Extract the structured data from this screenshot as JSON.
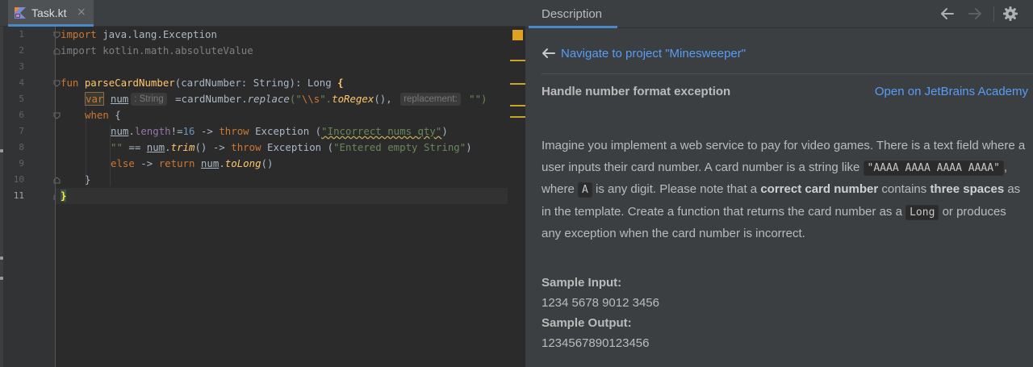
{
  "editor": {
    "tab": {
      "label": "Task.kt",
      "close": "×"
    },
    "line_numbers": [
      "1",
      "2",
      "3",
      "4",
      "5",
      "6",
      "7",
      "8",
      "9",
      "10",
      "11"
    ],
    "current_line": "11",
    "code": {
      "l1": {
        "kw": "import",
        "text": " java.lang.Exception"
      },
      "l2": {
        "text": "import kotlin.math.absoluteValue"
      },
      "l4": {
        "kw": "fun",
        "name": " parseCardNumber",
        "params": "(cardNumber: String): Long ",
        "brace": "{"
      },
      "l5": {
        "kw": "var",
        "name": "num",
        "hint": ": String",
        "assign": " =cardNumber.",
        "call": "replace",
        "open": "(\"",
        "esc": "\\\\s",
        "close": "\".",
        "call2": "toRegex",
        "after": "(), ",
        "hint2": "replacement:",
        "tail": " \"\")"
      },
      "l6": {
        "kw": "when",
        "text": " {"
      },
      "l7": {
        "var": "num",
        "dot": ".",
        "prop": "length",
        "op": "!=",
        "num": "16",
        "arrow": " -> ",
        "kw": "throw",
        "cls": " Exception (",
        "str": "\"Incorrect nums qty\"",
        "end": ")"
      },
      "l8": {
        "str": "\"\"",
        "eq": " == ",
        "var": "num",
        "dot": ".",
        "call": "trim",
        "mid": "() -> ",
        "kw": "throw",
        "cls": " Exception (",
        "str2": "\"Entered empty String\"",
        "end": ")"
      },
      "l9": {
        "kw": "else",
        "arrow": " -> ",
        "kw2": "return",
        "sp": " ",
        "var": "num",
        "dot": ".",
        "call": "toLong",
        "end": "()"
      },
      "l10": {
        "text": "}"
      },
      "l11": {
        "text": "}"
      }
    }
  },
  "description": {
    "tab_label": "Description",
    "icons": [
      "arrow-left-icon",
      "arrow-right-icon",
      "gear-icon"
    ],
    "nav_link": "Navigate to project \"Minesweeper\"",
    "task_title": "Handle number format exception",
    "academy_link": "Open on JetBrains Academy",
    "body": {
      "p1": "Imagine you implement a web service to pay for video games. There is a text field where a user inputs their card number. A card number is a string like ",
      "code1": "\"AAAA AAAA AAAA AAAA\"",
      "p2": ", where ",
      "code2": "A",
      "p3": " is any digit. Please note that a ",
      "b1": "correct card number",
      "p4": " contains ",
      "b2": "three spaces",
      "p5": " as in the template. Create a function that returns the card number as a ",
      "code3": "Long",
      "p6": " or produces any exception when the card number is incorrect."
    },
    "sample_input_label": "Sample Input:",
    "sample_input": "1234 5678 9012 3456",
    "sample_output_label": "Sample Output:",
    "sample_output": "1234567890123456"
  },
  "colors": {
    "keyword": "#cc7832",
    "string": "#6a8759",
    "function": "#ffc66d",
    "number": "#6897bb",
    "link": "#589df6",
    "accent": "#4a88c7"
  }
}
